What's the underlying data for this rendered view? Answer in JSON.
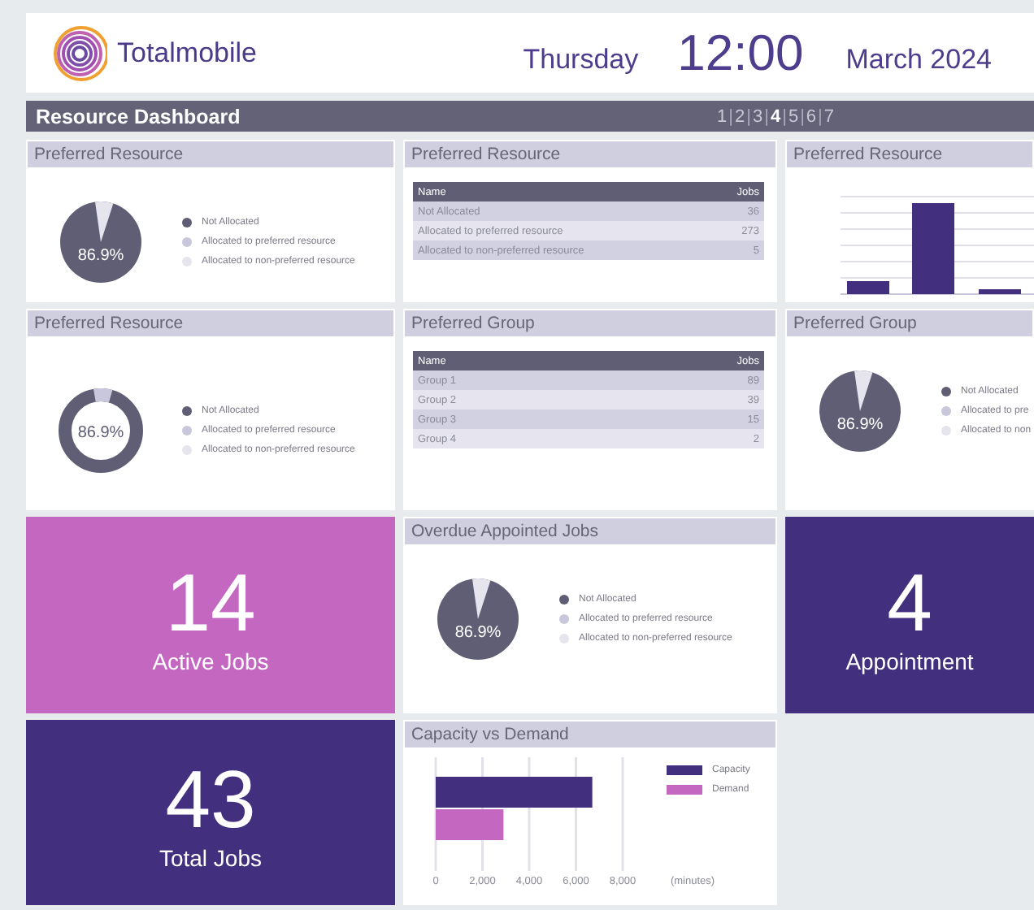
{
  "header": {
    "brand": "Totalmobile",
    "day": "Thursday",
    "time": "12:00",
    "month": "March 2024"
  },
  "dashboard": {
    "title": "Resource Dashboard",
    "pages": [
      {
        "label": "1",
        "selected": false
      },
      {
        "label": "2",
        "selected": false
      },
      {
        "label": "3",
        "selected": false
      },
      {
        "label": "4",
        "selected": true
      },
      {
        "label": "5",
        "selected": false
      },
      {
        "label": "6",
        "selected": false
      },
      {
        "label": "7",
        "selected": false
      }
    ],
    "separators": [
      "|",
      "|",
      "|",
      "|",
      "|",
      "|"
    ]
  },
  "cards": [
    {
      "kind": "pie",
      "title": "Preferred Resource",
      "value_label": "86.9%",
      "legend": [
        {
          "label": "Not Allocated",
          "color": "#5f5e74"
        },
        {
          "label": "Allocated to preferred resource",
          "color": "#c9c7dc"
        },
        {
          "label": "Allocated to non-preferred resource",
          "color": "#e6e5ee"
        }
      ]
    },
    {
      "kind": "table",
      "title": "Preferred Resource",
      "columns": [
        "Name",
        "Jobs"
      ],
      "rows": [
        [
          "Not Allocated",
          "36"
        ],
        [
          "Allocated to preferred resource",
          "273"
        ],
        [
          "Allocated to non-preferred resource",
          "5"
        ]
      ]
    },
    {
      "kind": "bars",
      "title": "Preferred Resource"
    },
    {
      "kind": "donut",
      "title": "Preferred Resource",
      "value_label": "86.9%",
      "legend": [
        {
          "label": "Not Allocated",
          "color": "#5f5e74"
        },
        {
          "label": "Allocated to preferred resource",
          "color": "#c9c7dc"
        },
        {
          "label": "Allocated to non-preferred resource",
          "color": "#e6e5ee"
        }
      ]
    },
    {
      "kind": "table",
      "title": "Preferred Group",
      "columns": [
        "Name",
        "Jobs"
      ],
      "rows": [
        [
          "Group 1",
          "89"
        ],
        [
          "Group 2",
          "39"
        ],
        [
          "Group 3",
          "15"
        ],
        [
          "Group 4",
          "2"
        ]
      ]
    },
    {
      "kind": "pie",
      "title": "Preferred Group",
      "value_label": "86.9%",
      "legend": [
        {
          "label": "Not Allocated",
          "color": "#5f5e74"
        },
        {
          "label": "Allocated to pre",
          "color": "#c9c7dc"
        },
        {
          "label": "Allocated to non",
          "color": "#e6e5ee"
        }
      ]
    },
    {
      "kind": "stat",
      "value": "14",
      "label": "Active Jobs",
      "color": "#c467c0"
    },
    {
      "kind": "pie",
      "title": "Overdue Appointed Jobs",
      "value_label": "86.9%",
      "legend": [
        {
          "label": "Not Allocated",
          "color": "#5f5e74"
        },
        {
          "label": "Allocated to preferred resource",
          "color": "#c9c7dc"
        },
        {
          "label": "Allocated to non-preferred resource",
          "color": "#e6e5ee"
        }
      ]
    },
    {
      "kind": "stat",
      "value": "4",
      "label": "Appointment",
      "color": "#42307f"
    },
    {
      "kind": "stat",
      "value": "43",
      "label": "Total Jobs",
      "color": "#42307f"
    },
    {
      "kind": "hbar",
      "title": "Capacity vs Demand",
      "chart_data": {
        "type": "bar",
        "orientation": "horizontal",
        "grid": true,
        "xlabel": "(minutes)",
        "xlim": [
          0,
          8000
        ],
        "xticks": [
          0,
          {
            "value": 2000,
            "label": "2,000"
          },
          {
            "value": 4000,
            "label": "4,000"
          },
          {
            "value": 6000,
            "label": "6,000"
          },
          {
            "value": 8000,
            "label": "8,000"
          }
        ],
        "series": [
          {
            "name": "Capacity",
            "color": "#42307f",
            "values": [
              6700
            ]
          },
          {
            "name": "Demand",
            "color": "#c467c0",
            "values": [
              2900
            ]
          }
        ]
      }
    }
  ]
}
